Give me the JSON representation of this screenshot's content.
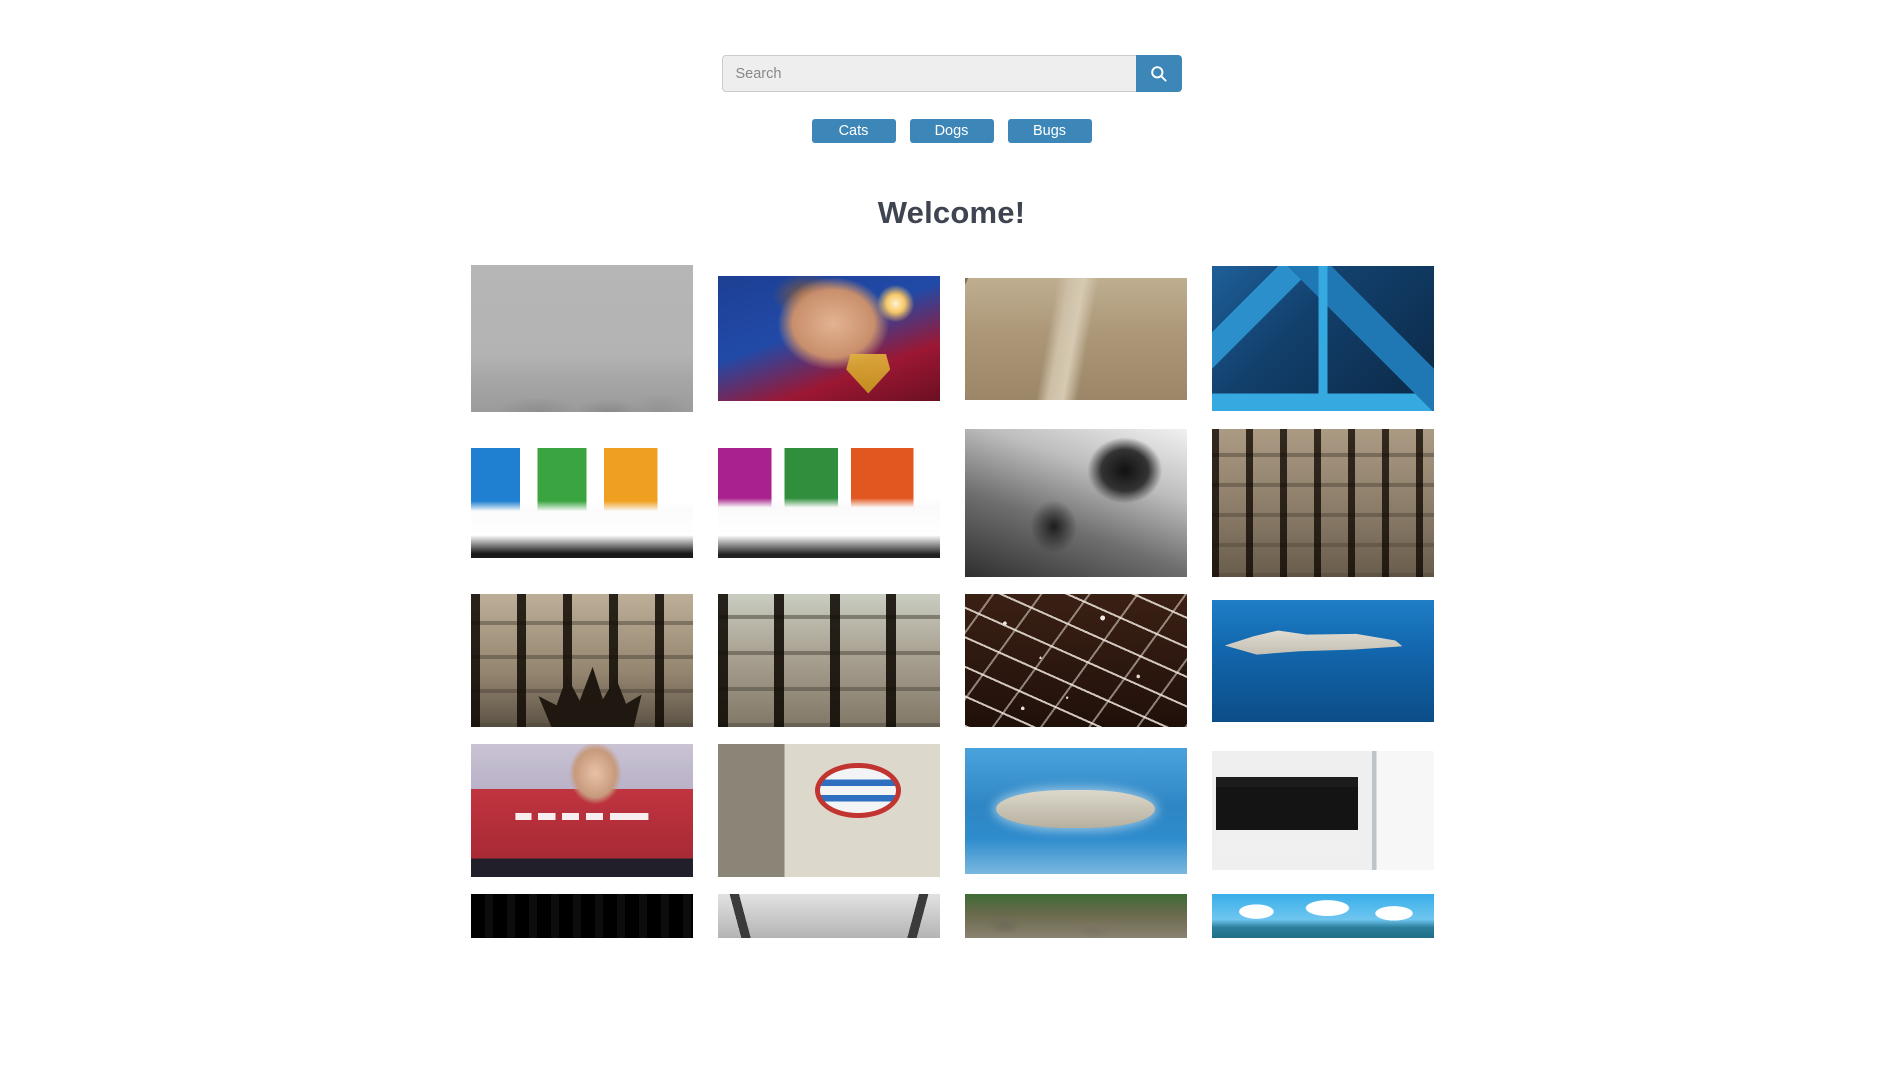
{
  "search": {
    "placeholder": "Search",
    "value": "",
    "button_icon": "search-icon"
  },
  "categories": [
    {
      "label": "Cats"
    },
    {
      "label": "Dogs"
    },
    {
      "label": "Bugs"
    }
  ],
  "heading": "Welcome!",
  "colors": {
    "accent": "#3d87b8",
    "heading_text": "#3f4550",
    "input_background": "#eeeeee",
    "input_border": "#cccccc",
    "page_background": "#ffffff",
    "button_text": "#ffffff",
    "placeholder_text": "#888888"
  },
  "gallery": {
    "columns": 4,
    "items": [
      {
        "name": "foggy-grey-landscape",
        "art": "art-fog"
      },
      {
        "name": "supergirl-portrait",
        "art": "art-hero"
      },
      {
        "name": "arid-canyon-aerial",
        "art": "art-canyon"
      },
      {
        "name": "blue-corporate-brochure",
        "art": "art-broch-blue"
      },
      {
        "name": "trifold-flyers-blue-green-orange",
        "art": "art-flyers-a"
      },
      {
        "name": "trifold-flyers-purple-green-orange",
        "art": "art-flyers-b"
      },
      {
        "name": "black-and-white-boxer",
        "art": "art-bw"
      },
      {
        "name": "sepia-interior-windows",
        "art": "art-sepia-wide"
      },
      {
        "name": "sepia-window-palm-silhouette",
        "art": "art-sepia-palm"
      },
      {
        "name": "sepia-window-grid",
        "art": "art-sepia-grid"
      },
      {
        "name": "dark-splatter-macro",
        "art": "art-splatter"
      },
      {
        "name": "navy-jet-over-sea",
        "art": "art-jet"
      },
      {
        "name": "strong-woman-render",
        "art": "art-strong"
      },
      {
        "name": "boycott-israel-wall-graffiti",
        "art": "art-wall"
      },
      {
        "name": "aerial-island-ocean",
        "art": "art-island"
      },
      {
        "name": "javascript-lecture-screen",
        "art": "art-screen"
      },
      {
        "name": "dark-forest-partial",
        "art": "art-dark"
      },
      {
        "name": "grey-arches-partial",
        "art": "art-arches"
      },
      {
        "name": "mossy-rocks-partial",
        "art": "art-rocks"
      },
      {
        "name": "blue-sky-clouds-partial",
        "art": "art-clouds"
      }
    ]
  }
}
